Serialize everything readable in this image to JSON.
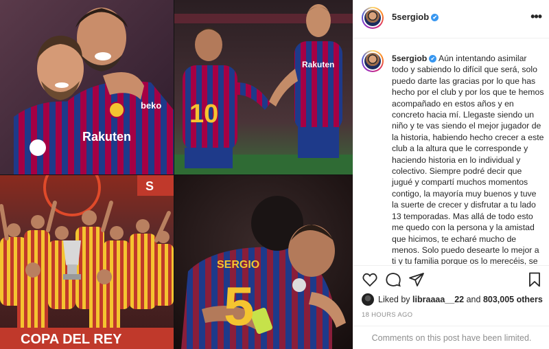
{
  "post": {
    "username": "5sergiob",
    "caption_username": "5sergiob",
    "caption": "Aún intentando asimilar todo y sabiendo lo difícil que será, solo puedo darte las gracias por lo que has hecho por el club y por los que te hemos acompañado en estos años y en concreto hacia mí. Llegaste siendo un niño y te vas siendo el mejor jugador de la historia, habiendo hecho crecer a este club a la altura que le corresponde y haciendo historia en lo individual y colectivo. Siempre podré decir que jugué y compartí muchos momentos contigo, la mayoría muy buenos y tuve la suerte de crecer y disfrutar a tu lado 13 temporadas. Mas allá de todo esto me quedo con la persona y la amistad que hicimos, te echaré mucho de menos. Solo puedo desearte lo mejor a ti y tu familia porque os lo merecéis, se os echará de",
    "likes_prefix": "Liked by",
    "liked_by_user": "libraaaa__22",
    "likes_and": "and",
    "likes_count": "803,005 others",
    "time_ago": "18 HOURS AGO",
    "comments_notice": "Comments on this post have been limited.",
    "verified_icon": "✔"
  },
  "photos": {
    "p1_shirt_text": "Rakuten",
    "p1_brand": "beko",
    "p2_number": "10",
    "p2_brand": "Rakuten",
    "p3_banner": "S",
    "p3_banner_text": "COPA DEL REY",
    "p4_name": "SERGIO",
    "p4_number": "5"
  },
  "icons": {
    "like": "heart-icon",
    "comment": "comment-icon",
    "share": "paper-plane-icon",
    "save": "bookmark-icon",
    "more": "more-options-icon"
  },
  "colors": {
    "verified": "#3897f0",
    "muted": "#8e8e8e",
    "text": "#262626",
    "barca_blue": "#1e3a8a",
    "barca_red": "#a50044"
  }
}
